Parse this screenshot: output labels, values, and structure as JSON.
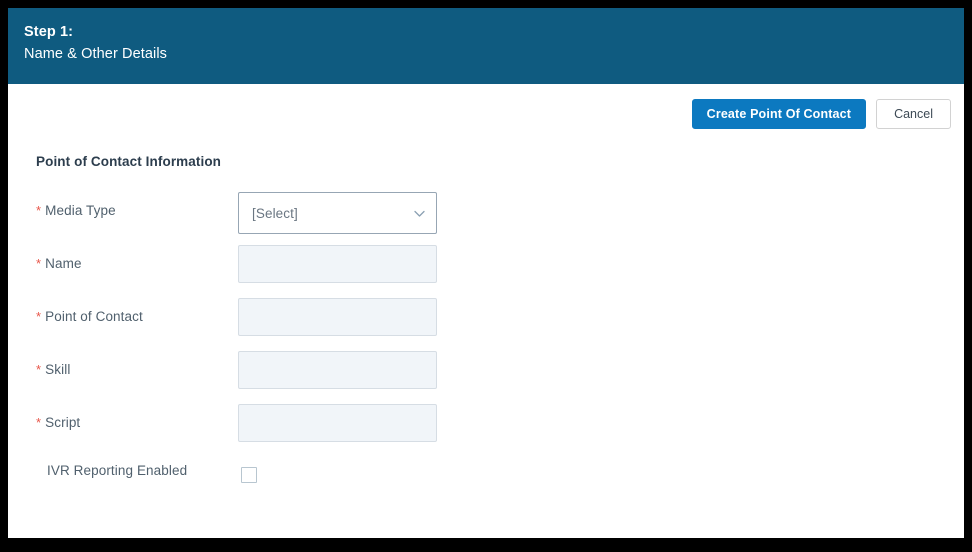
{
  "header": {
    "step_number": "Step 1:",
    "step_title": "Name & Other Details",
    "background_color": "#0f5b80"
  },
  "actions": {
    "primary_label": "Create Point Of Contact",
    "secondary_label": "Cancel",
    "primary_color": "#0c79c0"
  },
  "form": {
    "section_title": "Point of Contact Information",
    "required_marker": "*",
    "required_color": "#e8564a",
    "fields": [
      {
        "label": "Media Type",
        "required": true,
        "type": "select",
        "value": "[Select]",
        "icon": "chevron-down-icon"
      },
      {
        "label": "Name",
        "required": true,
        "type": "text",
        "value": "",
        "placeholder": ""
      },
      {
        "label": "Point of Contact",
        "required": true,
        "type": "text",
        "value": "",
        "placeholder": ""
      },
      {
        "label": "Skill",
        "required": true,
        "type": "text",
        "value": "",
        "placeholder": ""
      },
      {
        "label": "Script",
        "required": true,
        "type": "text",
        "value": "",
        "placeholder": ""
      },
      {
        "label": "IVR Reporting Enabled",
        "required": false,
        "type": "checkbox",
        "checked": false
      }
    ]
  }
}
